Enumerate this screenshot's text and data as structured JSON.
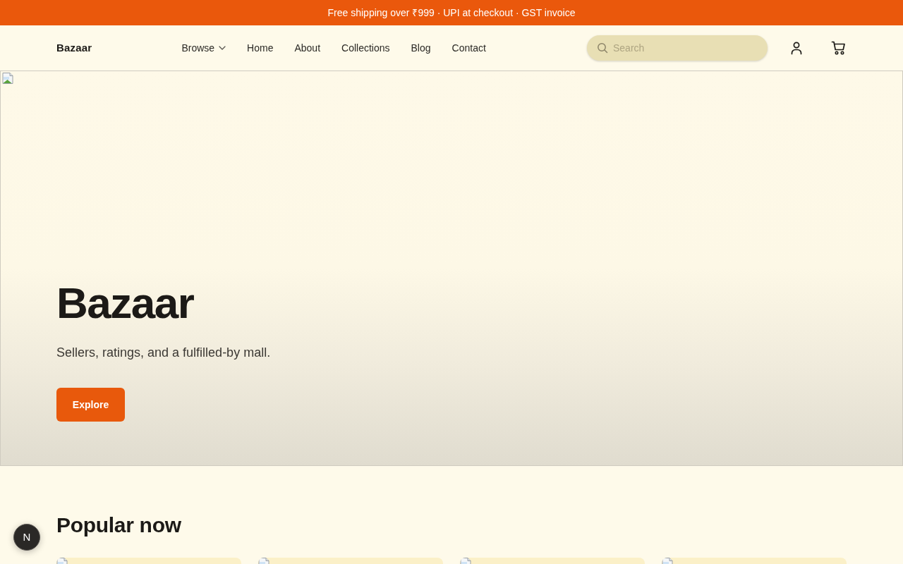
{
  "banner": {
    "text": "Free shipping over ₹999 · UPI at checkout · GST invoice"
  },
  "header": {
    "logo": "Bazaar",
    "nav": [
      {
        "label": "Browse",
        "dropdown": true
      },
      {
        "label": "Home",
        "dropdown": false
      },
      {
        "label": "About",
        "dropdown": false
      },
      {
        "label": "Collections",
        "dropdown": false
      },
      {
        "label": "Blog",
        "dropdown": false
      },
      {
        "label": "Contact",
        "dropdown": false
      }
    ],
    "search": {
      "placeholder": "Search"
    }
  },
  "hero": {
    "title": "Bazaar",
    "subtitle": "Sellers, ratings, and a fulfilled-by mall.",
    "button": "Explore"
  },
  "popular": {
    "heading": "Popular now",
    "products": [
      {
        "kind": "broken-image"
      },
      {
        "kind": "broken-image"
      },
      {
        "kind": "broken-image"
      },
      {
        "kind": "broken-image"
      }
    ]
  },
  "dev_indicator": {
    "label": "N"
  }
}
